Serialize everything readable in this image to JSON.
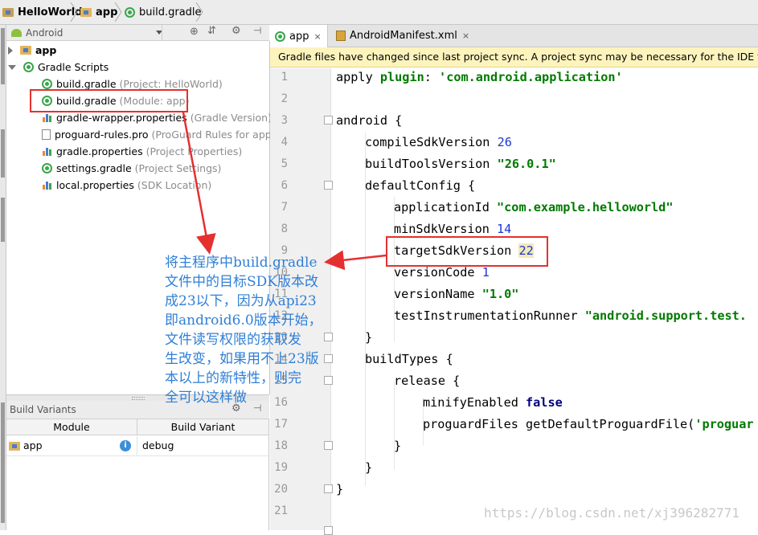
{
  "breadcrumb": [
    "HelloWorld",
    "app",
    "build.gradle"
  ],
  "project_panel": {
    "view_selector": "Android",
    "tree": [
      {
        "label": "app",
        "hint": ""
      },
      {
        "label": "Gradle Scripts",
        "hint": ""
      },
      {
        "label": "build.gradle",
        "hint": "(Project: HelloWorld)"
      },
      {
        "label": "build.gradle",
        "hint": "(Module: app)"
      },
      {
        "label": "gradle-wrapper.properties",
        "hint": "(Gradle Version)"
      },
      {
        "label": "proguard-rules.pro",
        "hint": "(ProGuard Rules for app)"
      },
      {
        "label": "gradle.properties",
        "hint": "(Project Properties)"
      },
      {
        "label": "settings.gradle",
        "hint": "(Project Settings)"
      },
      {
        "label": "local.properties",
        "hint": "(SDK Location)"
      }
    ]
  },
  "build_variants": {
    "title": "Build Variants",
    "columns": [
      "Module",
      "Build Variant"
    ],
    "rows": [
      {
        "module": "app",
        "variant": "debug"
      }
    ]
  },
  "editor": {
    "tabs": [
      {
        "label": "app",
        "close": "×"
      },
      {
        "label": "AndroidManifest.xml",
        "close": "×"
      }
    ],
    "banner": "Gradle files have changed since last project sync. A project sync may be necessary for the IDE to work",
    "line_numbers": [
      "1",
      "2",
      "3",
      "4",
      "5",
      "6",
      "7",
      "8",
      "9",
      "10",
      "11",
      "12",
      "13",
      "14",
      "15",
      "16",
      "17",
      "18",
      "19",
      "20",
      "21"
    ],
    "code": {
      "l1_pre": "apply ",
      "l1_kw": "plugin",
      "l1_mid": ": ",
      "l1_str": "'com.android.application'",
      "l3": "android {",
      "l4_a": "compileSdkVersion ",
      "l4_n": "26",
      "l5_a": "buildToolsVersion ",
      "l5_s": "\"26.0.1\"",
      "l6": "defaultConfig {",
      "l7_a": "applicationId ",
      "l7_s": "\"com.example.helloworld\"",
      "l8_a": "minSdkVersion ",
      "l8_n": "14",
      "l9_a": "targetSdkVersion ",
      "l9_n": "22",
      "l10_a": "versionCode ",
      "l10_n": "1",
      "l11_a": "versionName ",
      "l11_s": "\"1.0\"",
      "l12_a": "testInstrumentationRunner ",
      "l12_s": "\"android.support.test.",
      "l13": "}",
      "l14": "buildTypes {",
      "l15": "release {",
      "l16_a": "minifyEnabled ",
      "l16_k": "false",
      "l17_a": "proguardFiles getDefaultProguardFile(",
      "l17_s": "'proguar",
      "l18": "}",
      "l19": "}",
      "l20": "}"
    }
  },
  "annotation": {
    "text": "将主程序中build.gradle\n文件中的目标SDK版本改\n成23以下，因为从api23\n即android6.0版本开始，\n文件读写权限的获取发\n生改变，如果用不上23版\n本以上的新特性，则完\n全可以这样做"
  },
  "watermark": "https://blog.csdn.net/xj396282771",
  "colors": {
    "accent_red": "#e53030",
    "annotation_blue": "#2f7fd6",
    "banner_bg": "#fdf4bd",
    "string_green": "#007a00",
    "number_blue": "#1a37d6"
  }
}
